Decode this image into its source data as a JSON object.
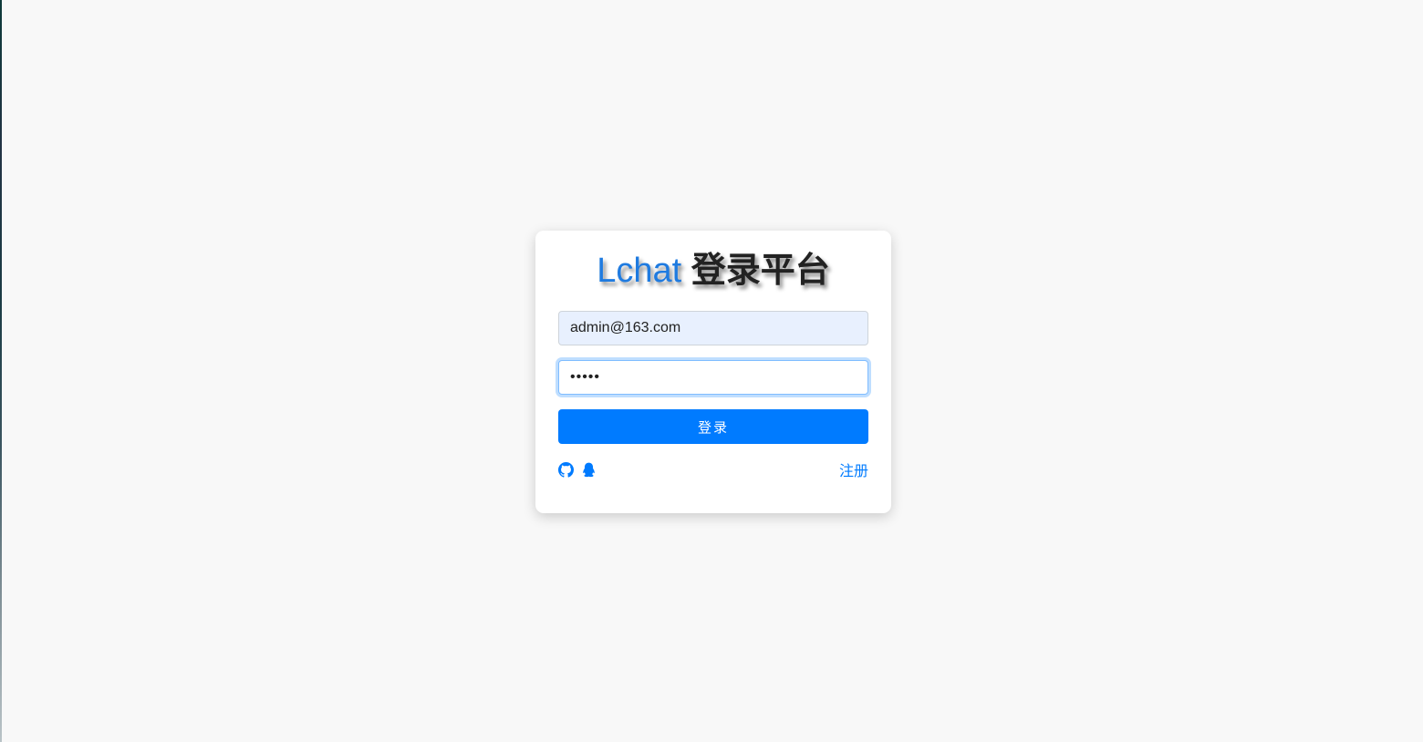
{
  "login": {
    "title_brand": "Lchat",
    "title_rest": "登录平台",
    "email_value": "admin@163.com",
    "password_value": "•••••",
    "submit_label": "登录",
    "register_label": "注册"
  },
  "social": [
    {
      "icon": "github-icon"
    },
    {
      "icon": "qq-icon"
    }
  ],
  "colors": {
    "page_background": "#f8f8f8",
    "brand": "#1f7be0",
    "primary_button": "#007bff",
    "link": "#007bff",
    "autofill_background": "#e8f0fe"
  }
}
